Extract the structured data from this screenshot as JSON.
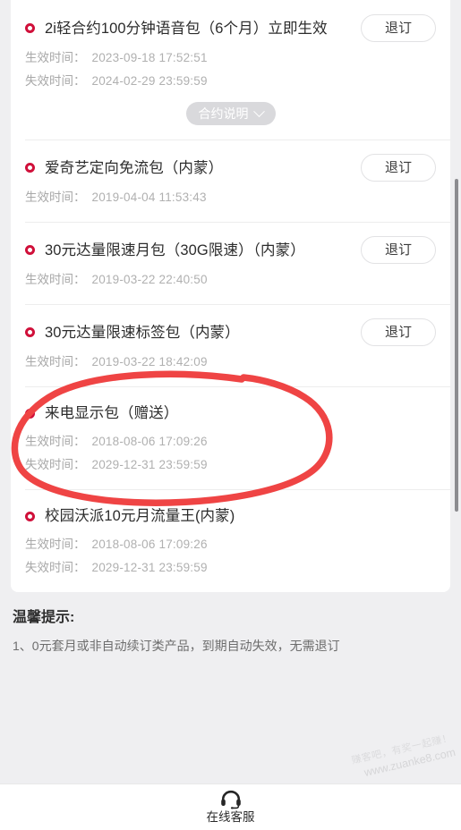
{
  "theme": {
    "page_bg": "#efeff1",
    "card_bg": "#ffffff",
    "bullet_color": "#d0103a",
    "annotation_color": "#ef4444",
    "muted_text": "#a6a6a6",
    "title_text": "#2c2c2c"
  },
  "labels": {
    "effective_time": "生效时间：",
    "expire_time": "失效时间：",
    "unsubscribe": "退订",
    "contract_note": "合约说明"
  },
  "packages": [
    {
      "name": "2i轻合约100分钟语音包（6个月）立即生效",
      "effective_time": "2023-09-18 17:52:51",
      "expire_time": "2024-02-29 23:59:59",
      "action": "退订",
      "has_contract_note": true,
      "contract_note": "合约说明"
    },
    {
      "name": "爱奇艺定向免流包（内蒙）",
      "effective_time": "2019-04-04 11:53:43",
      "expire_time": "",
      "action": "退订",
      "has_contract_note": false
    },
    {
      "name": "30元达量限速月包（30G限速）（内蒙）",
      "effective_time": "2019-03-22 22:40:50",
      "expire_time": "",
      "action": "退订",
      "has_contract_note": false
    },
    {
      "name": "30元达量限速标签包（内蒙）",
      "effective_time": "2019-03-22 18:42:09",
      "expire_time": "",
      "action": "退订",
      "has_contract_note": false,
      "annotated": true
    },
    {
      "name": "来电显示包（赠送）",
      "effective_time": "2018-08-06 17:09:26",
      "expire_time": "2029-12-31 23:59:59",
      "action": "",
      "has_contract_note": false
    },
    {
      "name": "校园沃派10元月流量王(内蒙)",
      "effective_time": "2018-08-06 17:09:26",
      "expire_time": "2029-12-31 23:59:59",
      "action": "",
      "has_contract_note": false
    }
  ],
  "tips": {
    "title": "温馨提示:",
    "line1": "1、0元套月或非自动续订类产品，到期自动失效，无需退订"
  },
  "footer": {
    "icon": "headset-icon",
    "label": "在线客服"
  },
  "watermark": {
    "line1": "赚客吧，有奖一起赚！",
    "line2": "www.zuanke8.com"
  },
  "scrollbar": {
    "visible": true
  }
}
